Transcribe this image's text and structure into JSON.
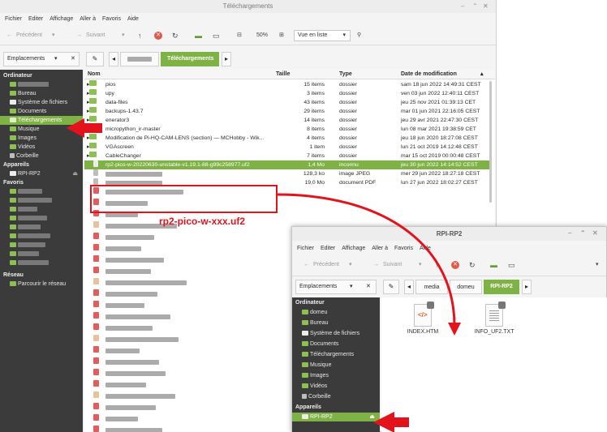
{
  "main_window": {
    "title": "Téléchargements",
    "menu": [
      "Fichier",
      "Editer",
      "Affichage",
      "Aller à",
      "Favoris",
      "Aide"
    ],
    "toolbar": {
      "back_label": "Précédent",
      "forward_label": "Suivant",
      "zoom": "50%",
      "view_mode": "Vue en liste"
    },
    "location_selector": "Emplacements",
    "breadcrumb_active": "Téléchargements",
    "columns": [
      "Nom",
      "Taille",
      "Type",
      "Date de modification"
    ],
    "sidebar": {
      "section_computer": "Ordinateur",
      "computer_items": [
        "Bureau",
        "Système de fichiers",
        "Documents",
        "Téléchargements",
        "Musique",
        "Images",
        "Vidéos",
        "Corbeille"
      ],
      "section_devices": "Appareils",
      "device_item": "RPI-RP2",
      "section_favorites": "Favoris",
      "section_network": "Réseau",
      "network_item": "Parcourir le réseau"
    },
    "files": [
      {
        "name": "pios",
        "size": "15 items",
        "type": "dossier",
        "date": "sam 18 jun 2022 14:49:31 CEST"
      },
      {
        "name": "upy",
        "size": "3 items",
        "type": "dossier",
        "date": "ven 03 jun 2022 12:40:11 CEST"
      },
      {
        "name": "data-files",
        "size": "43 items",
        "type": "dossier",
        "date": "jeu 25 nov 2021 01:39:13 CET"
      },
      {
        "name": "backups-1.43.7",
        "size": "29 items",
        "type": "dossier",
        "date": "mar 01 jun 2021 22:16:05 CEST"
      },
      {
        "name": "enerator3",
        "size": "14 items",
        "type": "dossier",
        "date": "jeu 29 avr 2021 22:47:30 CEST"
      },
      {
        "name": "micropython_ir-master",
        "size": "8 items",
        "type": "dossier",
        "date": "lun 08 mar 2021 19:38:59 CET"
      },
      {
        "name": "Modification de Pi-HQ-CAM-LENS (section) — MCHobby - Wik...",
        "size": "4 items",
        "type": "dossier",
        "date": "jeu 18 jun 2020 18:27:08 CEST"
      },
      {
        "name": "VGAscreen",
        "size": "1 item",
        "type": "dossier",
        "date": "lun 21 oct 2019 14:12:48 CEST"
      },
      {
        "name": "CableChanger",
        "size": "7 items",
        "type": "dossier",
        "date": "mar 15 oct 2019 00:00:48 CEST"
      },
      {
        "name": "rp2-pico-w-20220630-unstable-v1.19.1-88-g99c258977.uf2",
        "size": "1,4 Mo",
        "type": "inconnu",
        "date": "jeu 30 jun 2022 14:14:52 CEST"
      },
      {
        "name": "",
        "size": "128,3 ko",
        "type": "image JPEG",
        "date": "mer 29 jun 2022 18:27:18 CEST"
      },
      {
        "name": "",
        "size": "19,0 Mo",
        "type": "document PDF",
        "date": "lun 27 jun 2022 18:02:27 CEST"
      }
    ],
    "annotation": "rp2-pico-w-xxx.uf2"
  },
  "rpi_window": {
    "title": "RPI-RP2",
    "menu": [
      "Fichier",
      "Editer",
      "Affichage",
      "Aller à",
      "Favoris",
      "Aide"
    ],
    "toolbar": {
      "back_label": "Précédent",
      "forward_label": "Suivant"
    },
    "location_selector": "Emplacements",
    "breadcrumbs": [
      "media",
      "domeu",
      "RPI-RP2"
    ],
    "sidebar": {
      "section_computer": "Ordinateur",
      "computer_items": [
        "domeu",
        "Bureau",
        "Système de fichiers",
        "Documents",
        "Téléchargements",
        "Musique",
        "Images",
        "Vidéos",
        "Corbeille"
      ],
      "section_devices": "Appareils",
      "device_item": "RPI-RP2"
    },
    "files": [
      {
        "name": "INDEX.HTM",
        "icon": "html-file-icon"
      },
      {
        "name": "INFO_UF2.TXT",
        "icon": "text-file-icon"
      }
    ]
  },
  "colors": {
    "accent": "#7eb244",
    "sidebar_bg": "#3b3b3b",
    "annotation_red": "#e3131b",
    "folder": "#8cc152"
  }
}
